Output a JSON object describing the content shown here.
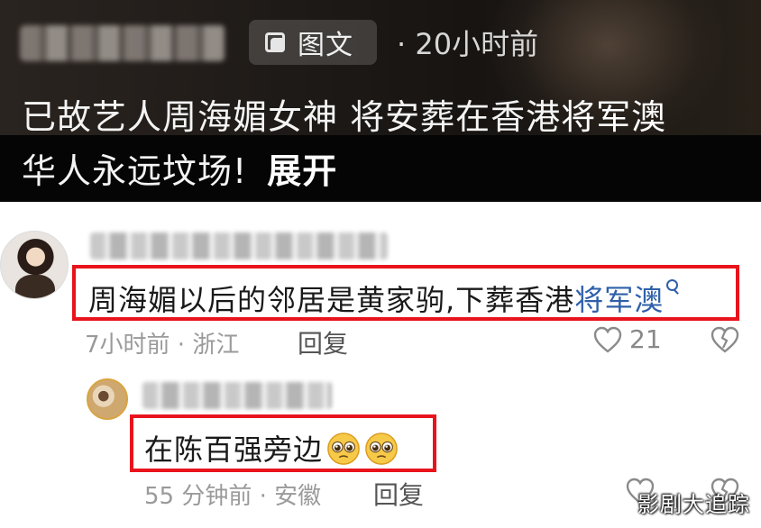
{
  "post": {
    "type_label": "图文",
    "time": "· 20小时前",
    "text_main": "已故艺人周海媚女神 将安葬在香港",
    "text_link": "将军澳",
    "text_line2": "华人永远坟场!",
    "expand_label": "展开"
  },
  "comments": [
    {
      "text_prefix": "周海媚以后的邻居是黄家驹,下葬香港",
      "text_keyword": "将军澳",
      "meta": "7小时前 · 浙江",
      "reply_label": "回复",
      "likes": "21"
    },
    {
      "text": "在陈百强旁边",
      "meta": "55 分钟前 · 安徽",
      "reply_label": "回复"
    }
  ],
  "watermark": "影剧大追踪",
  "colors": {
    "highlight": "#e8131c",
    "keyword": "#2f5fa9",
    "post_bg": "#1e1a17"
  },
  "icons": {
    "post_type": "image-text-icon",
    "search": "search-icon",
    "like": "heart-outline-icon",
    "dislike": "broken-heart-icon",
    "emoji": "pleading-face-emoji"
  }
}
